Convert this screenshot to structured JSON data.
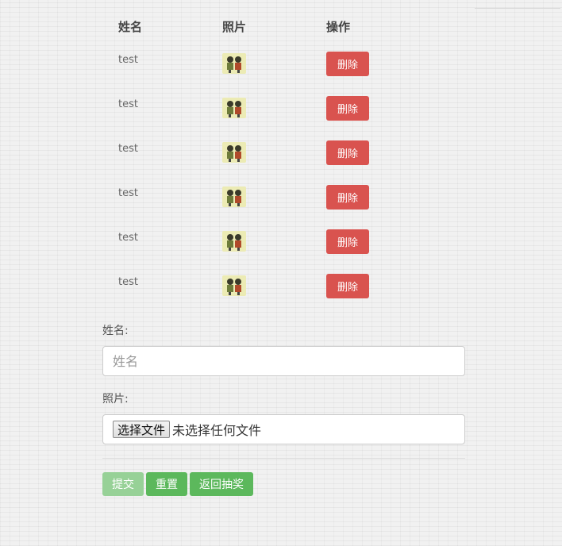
{
  "table": {
    "headers": {
      "name": "姓名",
      "photo": "照片",
      "action": "操作"
    },
    "rows": [
      {
        "name": "test",
        "delete_label": "删除"
      },
      {
        "name": "test",
        "delete_label": "删除"
      },
      {
        "name": "test",
        "delete_label": "删除"
      },
      {
        "name": "test",
        "delete_label": "删除"
      },
      {
        "name": "test",
        "delete_label": "删除"
      },
      {
        "name": "test",
        "delete_label": "删除"
      }
    ]
  },
  "form": {
    "name_label": "姓名:",
    "name_placeholder": "姓名",
    "name_value": "",
    "photo_label": "照片:",
    "file_button_label": "选择文件",
    "file_status": "未选择任何文件",
    "submit_label": "提交",
    "reset_label": "重置",
    "back_label": "返回抽奖"
  },
  "colors": {
    "danger": "#d9534f",
    "success": "#5cb85c",
    "success_disabled": "#97d197"
  }
}
